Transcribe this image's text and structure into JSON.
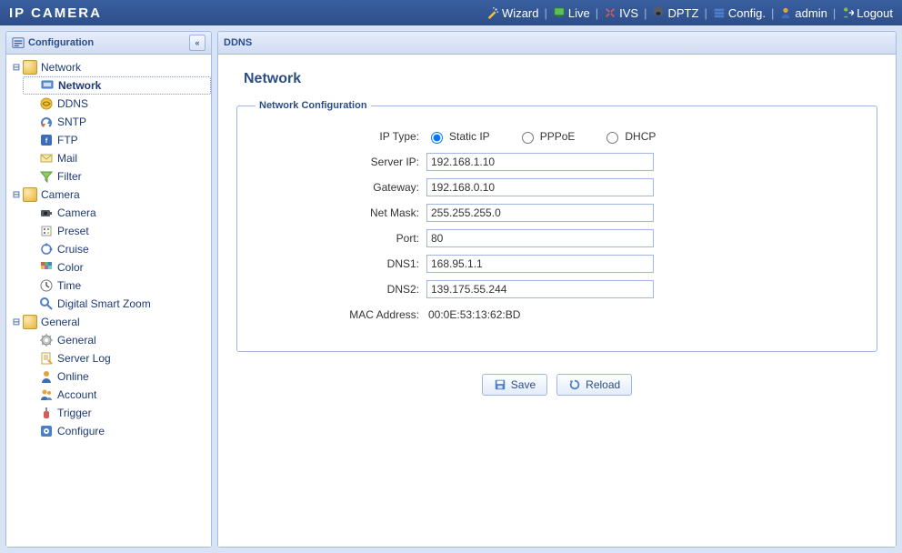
{
  "app_title": "IP CAMERA",
  "top_nav": {
    "wizard": "Wizard",
    "live": "Live",
    "ivs": "IVS",
    "dptz": "DPTZ",
    "config": "Config.",
    "admin": "admin",
    "logout": "Logout"
  },
  "sidebar": {
    "title": "Configuration",
    "collapse_glyph": "«",
    "groups": [
      {
        "label": "Network",
        "items": [
          {
            "label": "Network",
            "selected": true
          },
          {
            "label": "DDNS"
          },
          {
            "label": "SNTP"
          },
          {
            "label": "FTP"
          },
          {
            "label": "Mail"
          },
          {
            "label": "Filter"
          }
        ]
      },
      {
        "label": "Camera",
        "items": [
          {
            "label": "Camera"
          },
          {
            "label": "Preset"
          },
          {
            "label": "Cruise"
          },
          {
            "label": "Color"
          },
          {
            "label": "Time"
          },
          {
            "label": "Digital Smart Zoom"
          }
        ]
      },
      {
        "label": "General",
        "items": [
          {
            "label": "General"
          },
          {
            "label": "Server Log"
          },
          {
            "label": "Online"
          },
          {
            "label": "Account"
          },
          {
            "label": "Trigger"
          },
          {
            "label": "Configure"
          }
        ]
      }
    ]
  },
  "main": {
    "panel_title": "DDNS",
    "page_title": "Network",
    "group_title": "Network Configuration",
    "labels": {
      "ip_type": "IP Type:",
      "server_ip": "Server IP:",
      "gateway": "Gateway:",
      "net_mask": "Net Mask:",
      "port": "Port:",
      "dns1": "DNS1:",
      "dns2": "DNS2:",
      "mac": "MAC Address:"
    },
    "ip_type_options": {
      "static": "Static IP",
      "pppoe": "PPPoE",
      "dhcp": "DHCP",
      "selected": "static"
    },
    "values": {
      "server_ip": "192.168.1.10",
      "gateway": "192.168.0.10",
      "net_mask": "255.255.255.0",
      "port": "80",
      "dns1": "168.95.1.1",
      "dns2": "139.175.55.244",
      "mac": "00:0E:53:13:62:BD"
    },
    "buttons": {
      "save": "Save",
      "reload": "Reload"
    }
  },
  "icon_colors": {
    "wizard": "#f5c13d",
    "live": "#5bbf5b",
    "ivs": "#d85b5b",
    "dptz": "#555c66",
    "config": "#4d7ec9",
    "admin": "#e8a23a",
    "logout": "#7fc24a"
  }
}
